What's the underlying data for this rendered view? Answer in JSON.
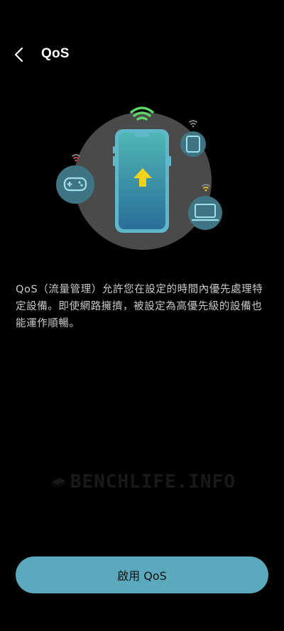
{
  "header": {
    "back_icon": "chevron-left-icon",
    "title": "QoS"
  },
  "illustration": {
    "icons": [
      "phone-icon",
      "upload-arrow-icon",
      "wifi-icon",
      "gamepad-icon",
      "tablet-icon",
      "laptop-icon"
    ],
    "colors": {
      "circle": "#4a4a4a",
      "device_bubble": "#3f7583",
      "phone_gradient_top": "#4fb6b4",
      "phone_gradient_bottom": "#2a6e9a",
      "arrow": "#f2d31b",
      "wifi_main": "#5ed66b",
      "wifi_red": "#e05050",
      "wifi_yellow": "#e6c229"
    }
  },
  "description": "QoS（流量管理）允許您在設定的時間內優先處理特定設備。即使網路擁擠，被設定為高優先級的設備也能運作順暢。",
  "watermark": {
    "text": "BENCHLIFE.INFO"
  },
  "enable_button": {
    "label": "啟用 QoS",
    "color": "#5aa9bc"
  }
}
